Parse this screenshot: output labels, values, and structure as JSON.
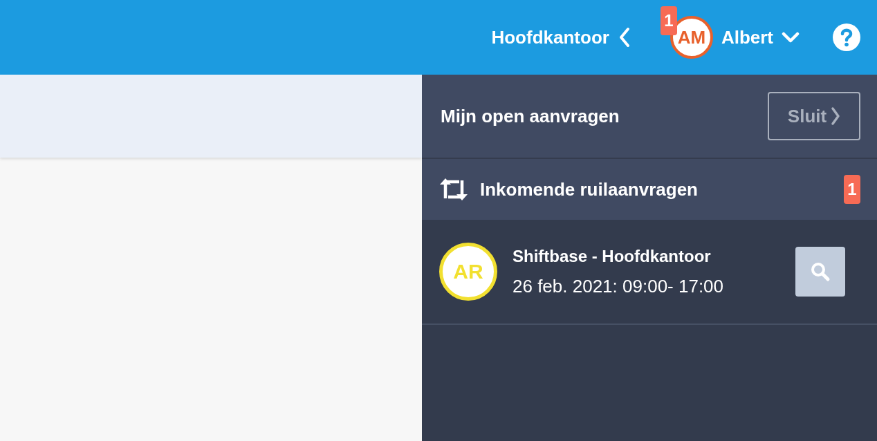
{
  "header": {
    "location": "Hoofdkantoor",
    "user": {
      "initials": "AM",
      "name": "Albert",
      "badge": "1"
    }
  },
  "panel": {
    "title": "Mijn open aanvragen",
    "close_button": "Sluit",
    "sections": [
      {
        "title": "Inkomende ruilaanvragen",
        "count": "1",
        "requests": [
          {
            "initials": "AR",
            "title": "Shiftbase - Hoofdkantoor",
            "time": "26 feb. 2021: 09:00- 17:00"
          }
        ]
      }
    ]
  }
}
